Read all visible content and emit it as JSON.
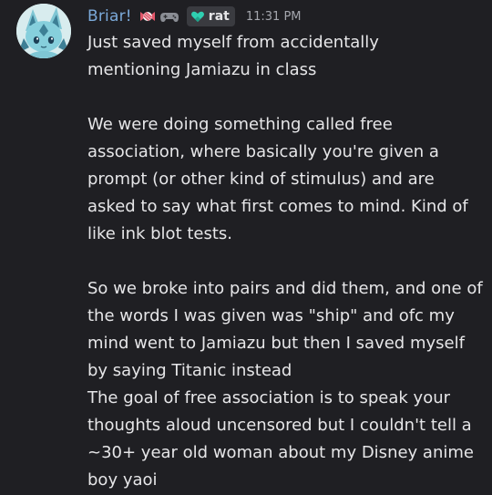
{
  "message": {
    "username": "Briar!",
    "username_color": "#7ba9d9",
    "emojis": [
      "candy-icon",
      "game-controller-icon"
    ],
    "tag": {
      "icon": "heart-icon",
      "label": "rat",
      "color": "#2fd0b1"
    },
    "timestamp": "11:31 PM",
    "avatar": "glaceon-avatar",
    "paragraphs": [
      "Just saved myself from accidentally\nmentioning Jamiazu in class",
      "We were doing something called free\nassociation, where basically you're given a\nprompt (or other kind of stimulus) and are\nasked to say what first comes to mind. Kind of\nlike ink blot tests.",
      "So we broke into pairs and did them, and one of\nthe words I was given was \"ship\" and ofc my\nmind went to Jamiazu but then I saved myself\nby saying Titanic instead",
      "The goal of free association is to speak your\nthoughts aloud uncensored but I couldn't tell a\n~30+ year old woman about my Disney anime\nboy yaoi"
    ]
  }
}
